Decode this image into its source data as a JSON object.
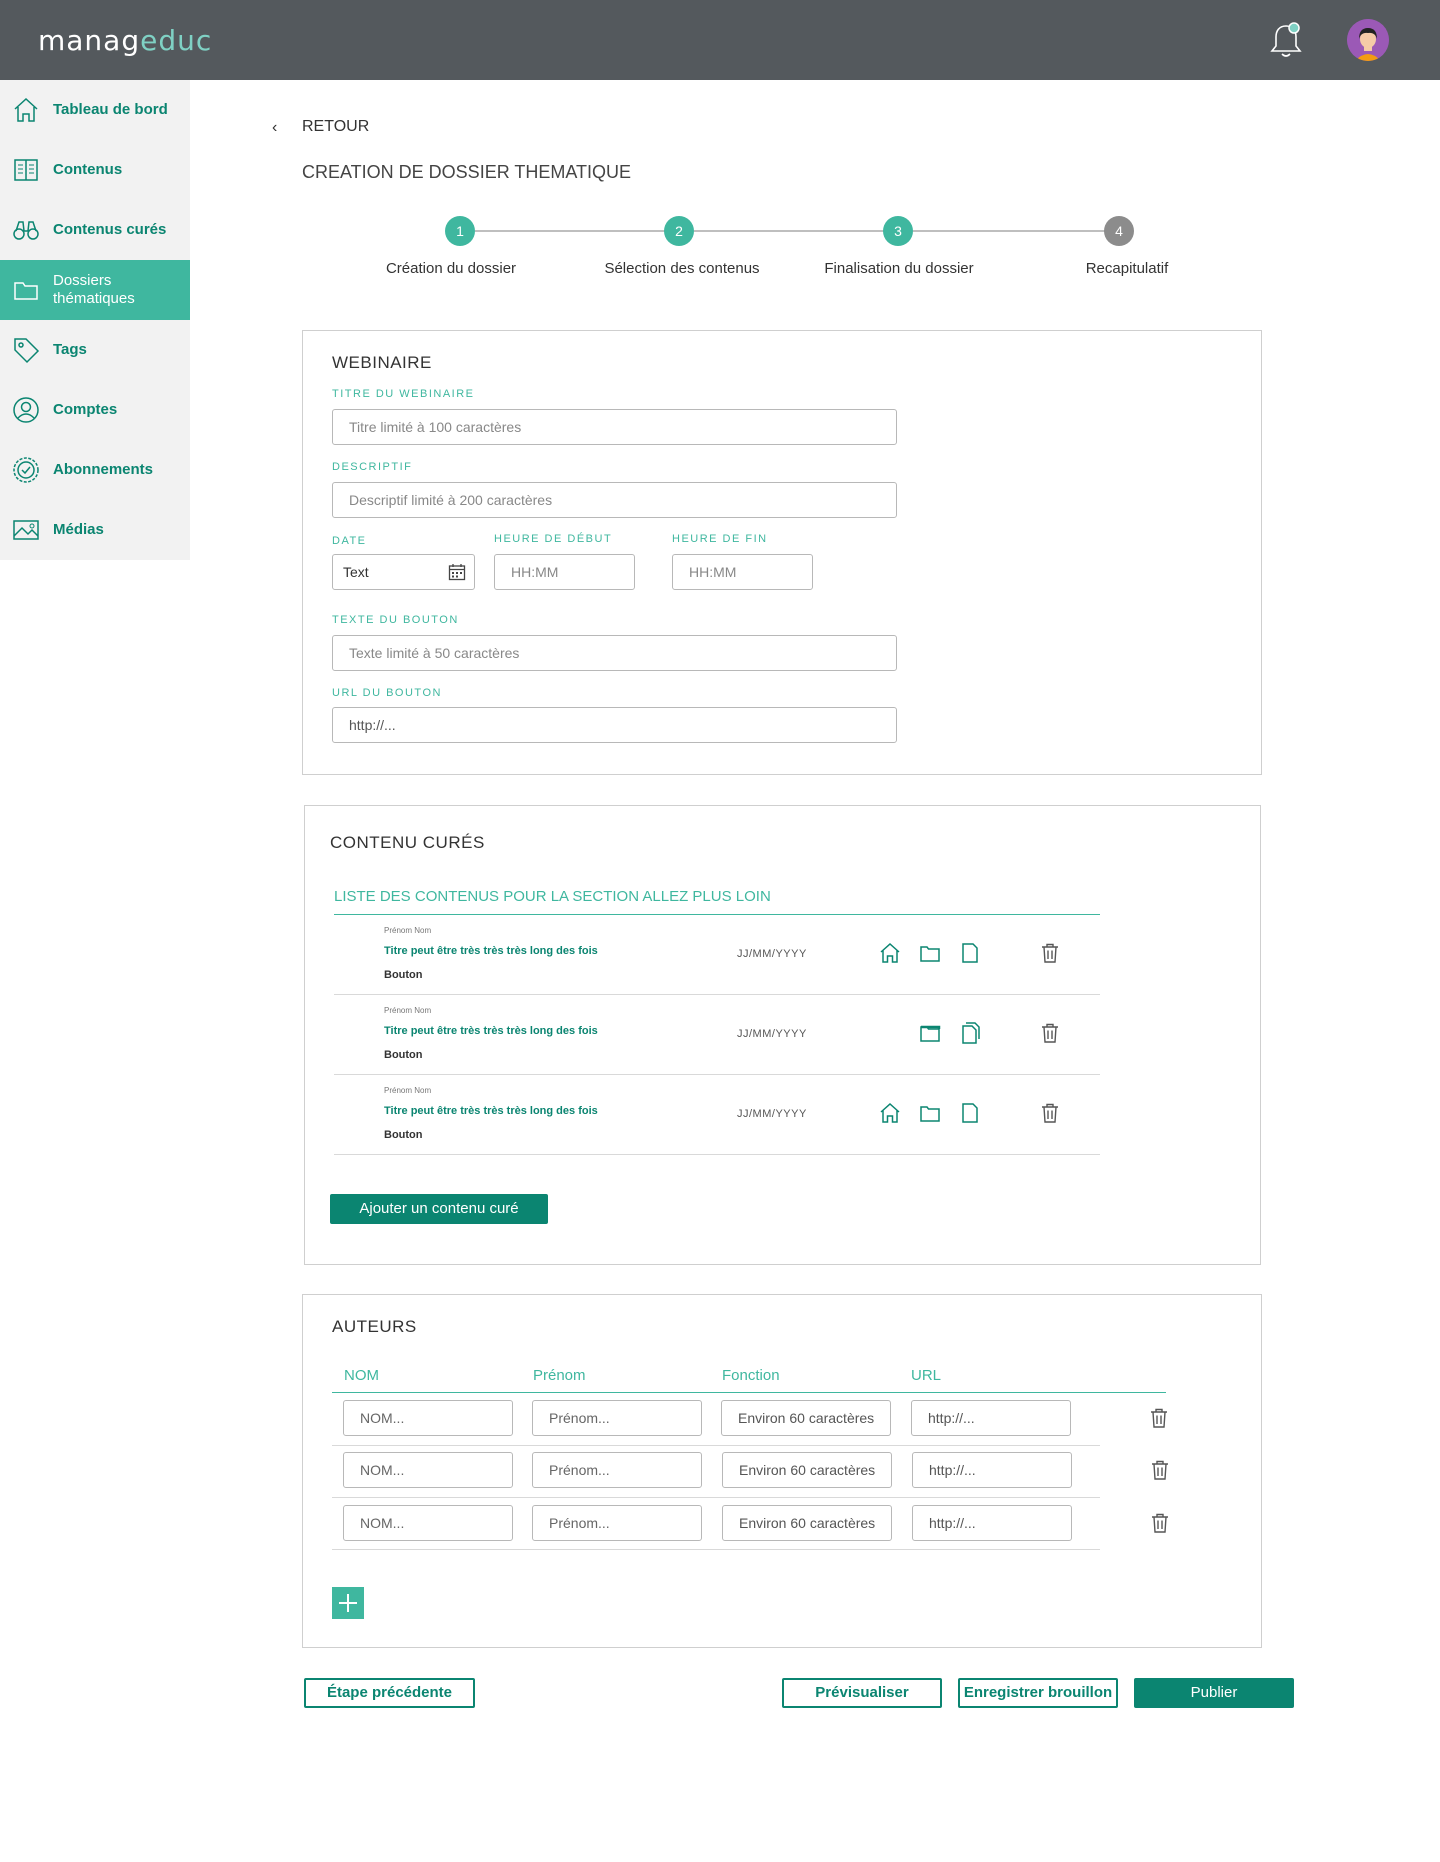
{
  "header": {
    "logo_part1": "manag",
    "logo_part2": "educ"
  },
  "sidebar": {
    "items": [
      {
        "label": "Tableau de bord",
        "icon": "home-icon"
      },
      {
        "label": "Contenus",
        "icon": "book-icon"
      },
      {
        "label": "Contenus curés",
        "icon": "binoculars-icon"
      },
      {
        "label": "Dossiers thématiques",
        "icon": "folder-icon",
        "active": true
      },
      {
        "label": "Tags",
        "icon": "tag-icon"
      },
      {
        "label": "Comptes",
        "icon": "user-icon"
      },
      {
        "label": "Abonnements",
        "icon": "badge-icon"
      },
      {
        "label": "Médias",
        "icon": "image-icon"
      }
    ]
  },
  "back_label": "RETOUR",
  "page_title": "CREATION DE DOSSIER THEMATIQUE",
  "stepper": {
    "steps": [
      {
        "num": "1",
        "label": "Création du dossier"
      },
      {
        "num": "2",
        "label": "Sélection des contenus"
      },
      {
        "num": "3",
        "label": "Finalisation du dossier"
      },
      {
        "num": "4",
        "label": "Recapitulatif"
      }
    ],
    "colors": {
      "done": "#3fb79f",
      "todo": "#8c8c8c"
    }
  },
  "webinaire": {
    "title": "WEBINAIRE",
    "titre_label": "TITRE DU WEBINAIRE",
    "titre_placeholder": "Titre limité à 100 caractères",
    "descriptif_label": "DESCRIPTIF",
    "descriptif_placeholder": "Descriptif limité à 200 caractères",
    "date_label": "DATE",
    "date_value": "Text",
    "heure_debut_label": "HEURE DE DÉBUT",
    "heure_debut_placeholder": "HH:MM",
    "heure_fin_label": "HEURE DE FIN",
    "heure_fin_placeholder": "HH:MM",
    "texte_bouton_label": "TEXTE DU BOUTON",
    "texte_bouton_placeholder": "Texte limité à 50 caractères",
    "url_bouton_label": "URL DU BOUTON",
    "url_bouton_placeholder": "http://..."
  },
  "contenus": {
    "title": "CONTENU CURÉS",
    "list_header": "LISTE DES CONTENUS POUR LA SECTION ALLEZ PLUS LOIN",
    "rows": [
      {
        "author": "Prénom Nom",
        "title": "Titre peut être très très très long des fois",
        "button": "Bouton",
        "date": "JJ/MM/YYYY"
      },
      {
        "author": "Prénom Nom",
        "title": "Titre peut être très très très long des fois",
        "button": "Bouton",
        "date": "JJ/MM/YYYY"
      },
      {
        "author": "Prénom Nom",
        "title": "Titre peut être très très très long des fois",
        "button": "Bouton",
        "date": "JJ/MM/YYYY"
      }
    ],
    "add_button": "Ajouter un contenu curé"
  },
  "auteurs": {
    "title": "AUTEURS",
    "columns": [
      "NOM",
      "Prénom",
      "Fonction",
      "URL"
    ],
    "rows": [
      {
        "nom": "NOM...",
        "prenom": "Prénom...",
        "fonction": "Environ 60 caractères",
        "url": "http://..."
      },
      {
        "nom": "NOM...",
        "prenom": "Prénom...",
        "fonction": "Environ 60 caractères",
        "url": "http://..."
      },
      {
        "nom": "NOM...",
        "prenom": "Prénom...",
        "fonction": "Environ 60 caractères",
        "url": "http://..."
      }
    ]
  },
  "footer": {
    "prev": "Étape précédente",
    "preview": "Prévisualiser",
    "draft": "Enregistrer brouillon",
    "publish": "Publier"
  },
  "colors": {
    "accent": "#3fb79f",
    "accent_dark": "#0b8571",
    "header_bg": "#54595d"
  }
}
